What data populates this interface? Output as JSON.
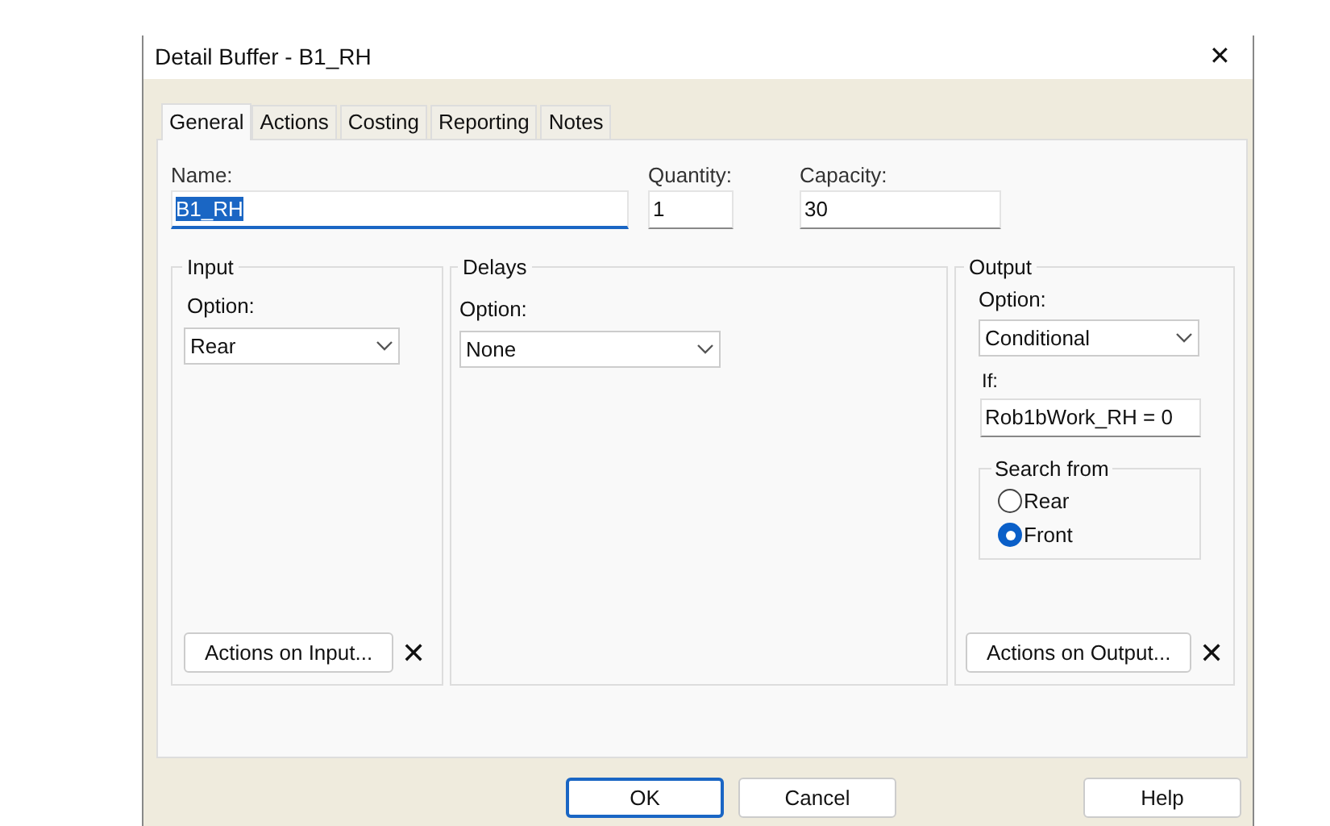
{
  "window": {
    "title": "Detail Buffer - B1_RH",
    "close": "✕"
  },
  "tabs": [
    {
      "label": "General",
      "selected": true
    },
    {
      "label": "Actions",
      "selected": false
    },
    {
      "label": "Costing",
      "selected": false
    },
    {
      "label": "Reporting",
      "selected": false
    },
    {
      "label": "Notes",
      "selected": false
    }
  ],
  "fields": [
    {
      "label": "Name:",
      "value": "B1_RH",
      "text_selected": true
    },
    {
      "label": "Quantity:",
      "value": "1",
      "text_selected": false
    },
    {
      "label": "Capacity:",
      "value": "30",
      "text_selected": false
    }
  ],
  "input": {
    "title": "Input",
    "option_label": "Option:",
    "option_value": "Rear",
    "button": "Actions on Input...",
    "clear": "✕"
  },
  "delays": {
    "title": "Delays",
    "option_label": "Option:",
    "option_value": "None"
  },
  "output": {
    "title": "Output",
    "option_label": "Option:",
    "option_value": "Conditional",
    "condition_label": "If:",
    "condition_value": "Rob1bWork_RH = 0",
    "search_from": {
      "title": "Search from",
      "options": [
        {
          "label": "Rear",
          "selected": false
        },
        {
          "label": "Front",
          "selected": true
        }
      ]
    },
    "button": "Actions on Output...",
    "clear": "✕"
  },
  "buttons": [
    {
      "label": "OK",
      "default": true
    },
    {
      "label": "Cancel",
      "default": false
    },
    {
      "label": "Help",
      "default": false
    }
  ]
}
